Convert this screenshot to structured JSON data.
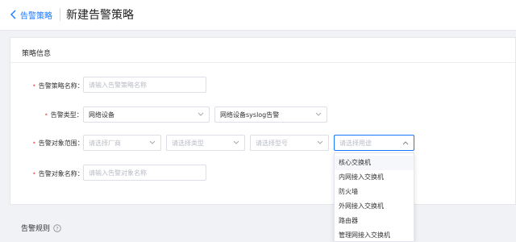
{
  "header": {
    "back_label": "告警策略",
    "title": "新建告警策略"
  },
  "card": {
    "title": "策略信息"
  },
  "form": {
    "name": {
      "label": "告警策略名称：",
      "placeholder": "请输入告警策略名称"
    },
    "type": {
      "label": "告警类型：",
      "value1": "网络设备",
      "value2": "网络设备syslog告警"
    },
    "scope": {
      "label": "告警对象范围：",
      "vendor_placeholder": "请选择厂商",
      "device_type_placeholder": "请选择类型",
      "model_placeholder": "请选择型号",
      "usage_placeholder": "请选择用途"
    },
    "object": {
      "label": "告警对象名称：",
      "placeholder": "请输入告警对象名称"
    }
  },
  "dropdown": {
    "options": [
      "核心交换机",
      "内网接入交换机",
      "防火墙",
      "外网接入交换机",
      "路由器",
      "管理网接入交换机"
    ]
  },
  "section2": {
    "title": "告警规则"
  },
  "colors": {
    "accent": "#1677ff",
    "required": "#f56c6c"
  }
}
